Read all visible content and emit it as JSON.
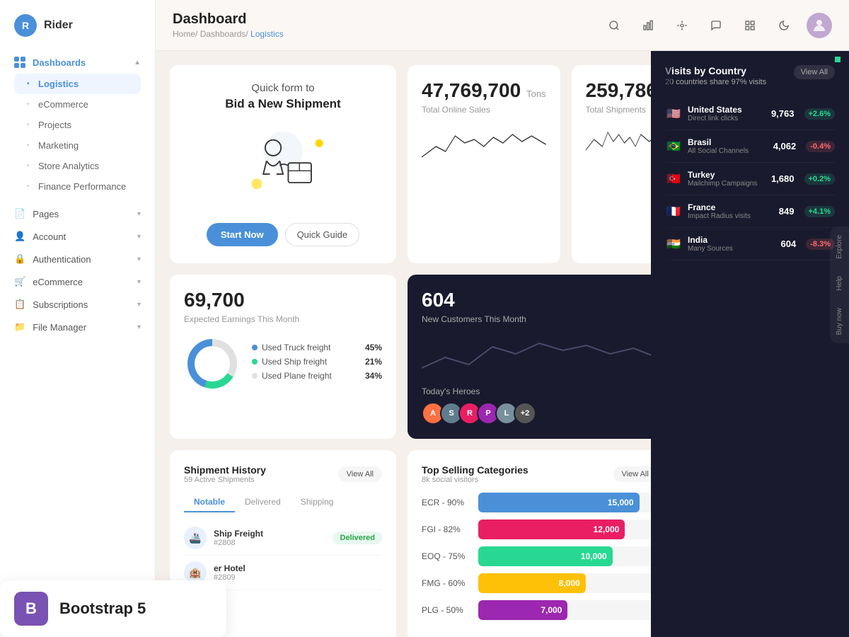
{
  "app": {
    "name": "Rider",
    "logo_letter": "R"
  },
  "header": {
    "title": "Dashboard",
    "breadcrumb": [
      "Home",
      "Dashboards",
      "Logistics"
    ]
  },
  "sidebar": {
    "dashboards_label": "Dashboards",
    "items": [
      {
        "label": "Logistics",
        "active": true
      },
      {
        "label": "eCommerce",
        "active": false
      },
      {
        "label": "Projects",
        "active": false
      },
      {
        "label": "Marketing",
        "active": false
      },
      {
        "label": "Store Analytics",
        "active": false
      },
      {
        "label": "Finance Performance",
        "active": false
      }
    ],
    "pages_label": "Pages",
    "account_label": "Account",
    "authentication_label": "Authentication",
    "ecommerce_label": "eCommerce",
    "subscriptions_label": "Subscriptions",
    "file_manager_label": "File Manager"
  },
  "promo": {
    "title": "Quick form to",
    "subtitle": "Bid a New Shipment",
    "btn_primary": "Start Now",
    "btn_secondary": "Quick Guide"
  },
  "stats": {
    "total_sales_value": "47,769,700",
    "total_sales_unit": "Tons",
    "total_sales_label": "Total Online Sales",
    "total_shipments_value": "259,786",
    "total_shipments_label": "Total Shipments",
    "earnings_value": "69,700",
    "earnings_label": "Expected Earnings This Month",
    "new_customers_value": "604",
    "new_customers_label": "New Customers This Month"
  },
  "freight": {
    "items": [
      {
        "label": "Used Truck freight",
        "pct": "45%",
        "color": "#4a90d9"
      },
      {
        "label": "Used Ship freight",
        "pct": "21%",
        "color": "#28d892"
      },
      {
        "label": "Used Plane freight",
        "pct": "34%",
        "color": "#e0e0e0"
      }
    ]
  },
  "heroes": {
    "label": "Today's Heroes",
    "avatars": [
      {
        "letter": "A",
        "bg": "#ff7043"
      },
      {
        "letter": "S",
        "bg": "#4a90d9"
      },
      {
        "letter": "R",
        "bg": "#e91e63"
      },
      {
        "letter": "P",
        "bg": "#9c27b0"
      },
      {
        "letter": "L",
        "bg": "#a0a0a0"
      },
      {
        "letter": "+2",
        "bg": "#555"
      }
    ]
  },
  "shipment_history": {
    "title": "Shipment History",
    "subtitle": "59 Active Shipments",
    "view_all": "View All",
    "tabs": [
      "Notable",
      "Delivered",
      "Shipping"
    ],
    "active_tab": "Notable",
    "rows": [
      {
        "icon": "🚢",
        "name": "Ship Freight",
        "id": "2808",
        "status": "Delivered",
        "status_type": "delivered"
      }
    ]
  },
  "categories": {
    "title": "Top Selling Categories",
    "subtitle": "8k social visitors",
    "view_all": "View All",
    "bars": [
      {
        "label": "ECR - 90%",
        "value": 15000,
        "display": "15,000",
        "pct": 90,
        "color": "#4a90d9"
      },
      {
        "label": "FGI - 82%",
        "value": 12000,
        "display": "12,000",
        "pct": 82,
        "color": "#e91e63"
      },
      {
        "label": "EOQ - 75%",
        "value": 10000,
        "display": "10,000",
        "pct": 75,
        "color": "#28d892"
      },
      {
        "label": "FMG - 60%",
        "value": 8000,
        "display": "8,000",
        "pct": 60,
        "color": "#ffc107"
      },
      {
        "label": "PLG - 50%",
        "value": 7000,
        "display": "7,000",
        "pct": 50,
        "color": "#9c27b0"
      }
    ]
  },
  "visits": {
    "title": "Visits by Country",
    "subtitle": "20 countries share 97% visits",
    "view_all": "View All",
    "countries": [
      {
        "name": "United States",
        "source": "Direct link clicks",
        "visits": "9,763",
        "change": "+2.6%",
        "change_type": "up",
        "flag": "🇺🇸"
      },
      {
        "name": "Brasil",
        "source": "All Social Channels",
        "visits": "4,062",
        "change": "-0.4%",
        "change_type": "down",
        "flag": "🇧🇷"
      },
      {
        "name": "Turkey",
        "source": "Mailchimp Campaigns",
        "visits": "1,680",
        "change": "+0.2%",
        "change_type": "up",
        "flag": "🇹🇷"
      },
      {
        "name": "France",
        "source": "Impact Radius visits",
        "visits": "849",
        "change": "+4.1%",
        "change_type": "up",
        "flag": "🇫🇷"
      },
      {
        "name": "India",
        "source": "Many Sources",
        "visits": "604",
        "change": "-8.3%",
        "change_type": "down",
        "flag": "🇮🇳"
      }
    ]
  },
  "side_tabs": [
    "Explore",
    "Help",
    "Buy now"
  ],
  "bootstrap": {
    "icon_letter": "B",
    "text": "Bootstrap 5"
  }
}
